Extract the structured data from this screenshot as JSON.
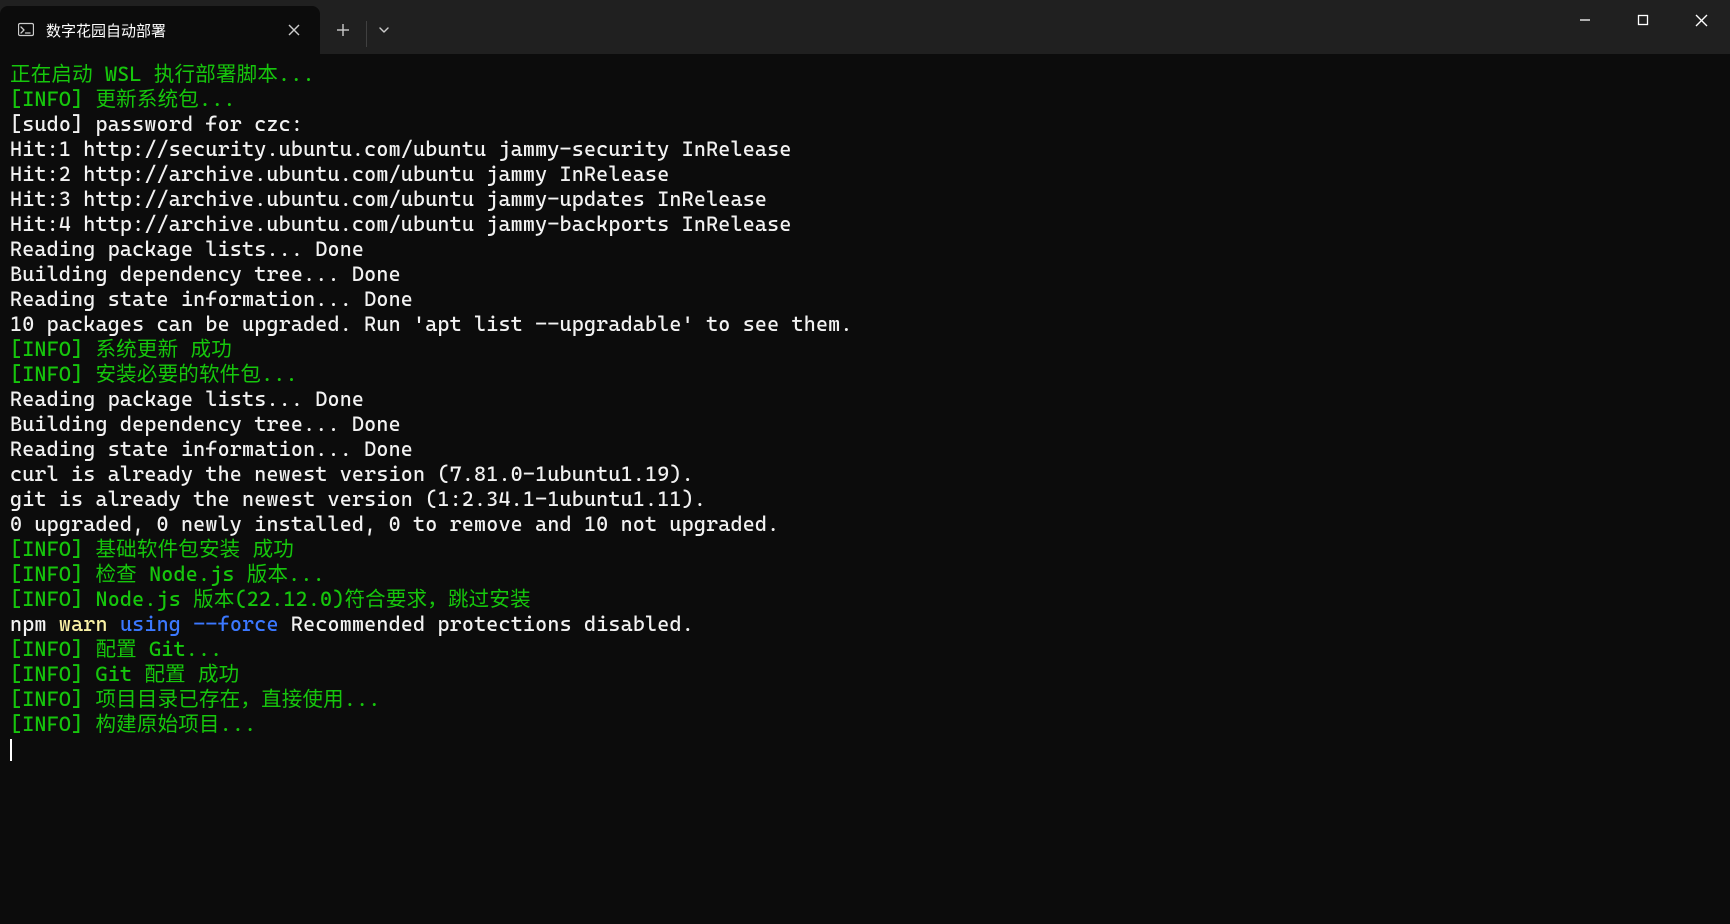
{
  "window": {
    "tab_title": "数字花园自动部署"
  },
  "colors": {
    "green": "#16c60c",
    "white": "#f2f2f2",
    "yellow": "#f9f1a5",
    "blue": "#3b78ff"
  },
  "lines": [
    {
      "segments": [
        {
          "text": "正在启动 WSL 执行部署脚本...",
          "cls": "c-green"
        }
      ]
    },
    {
      "segments": [
        {
          "text": "",
          "cls": "c-white"
        }
      ]
    },
    {
      "segments": [
        {
          "text": "[INFO] 更新系统包...",
          "cls": "c-green"
        }
      ]
    },
    {
      "segments": [
        {
          "text": "[sudo] password for czc:",
          "cls": "c-white"
        }
      ]
    },
    {
      "segments": [
        {
          "text": "Hit:1 http://security.ubuntu.com/ubuntu jammy-security InRelease",
          "cls": "c-white"
        }
      ]
    },
    {
      "segments": [
        {
          "text": "Hit:2 http://archive.ubuntu.com/ubuntu jammy InRelease",
          "cls": "c-white"
        }
      ]
    },
    {
      "segments": [
        {
          "text": "Hit:3 http://archive.ubuntu.com/ubuntu jammy-updates InRelease",
          "cls": "c-white"
        }
      ]
    },
    {
      "segments": [
        {
          "text": "Hit:4 http://archive.ubuntu.com/ubuntu jammy-backports InRelease",
          "cls": "c-white"
        }
      ]
    },
    {
      "segments": [
        {
          "text": "Reading package lists... Done",
          "cls": "c-white"
        }
      ]
    },
    {
      "segments": [
        {
          "text": "Building dependency tree... Done",
          "cls": "c-white"
        }
      ]
    },
    {
      "segments": [
        {
          "text": "Reading state information... Done",
          "cls": "c-white"
        }
      ]
    },
    {
      "segments": [
        {
          "text": "10 packages can be upgraded. Run 'apt list --upgradable' to see them.",
          "cls": "c-white"
        }
      ]
    },
    {
      "segments": [
        {
          "text": "[INFO] 系统更新 成功",
          "cls": "c-green"
        }
      ]
    },
    {
      "segments": [
        {
          "text": "[INFO] 安装必要的软件包...",
          "cls": "c-green"
        }
      ]
    },
    {
      "segments": [
        {
          "text": "Reading package lists... Done",
          "cls": "c-white"
        }
      ]
    },
    {
      "segments": [
        {
          "text": "Building dependency tree... Done",
          "cls": "c-white"
        }
      ]
    },
    {
      "segments": [
        {
          "text": "Reading state information... Done",
          "cls": "c-white"
        }
      ]
    },
    {
      "segments": [
        {
          "text": "curl is already the newest version (7.81.0-1ubuntu1.19).",
          "cls": "c-white"
        }
      ]
    },
    {
      "segments": [
        {
          "text": "git is already the newest version (1:2.34.1-1ubuntu1.11).",
          "cls": "c-white"
        }
      ]
    },
    {
      "segments": [
        {
          "text": "0 upgraded, 0 newly installed, 0 to remove and 10 not upgraded.",
          "cls": "c-white"
        }
      ]
    },
    {
      "segments": [
        {
          "text": "[INFO] 基础软件包安装 成功",
          "cls": "c-green"
        }
      ]
    },
    {
      "segments": [
        {
          "text": "[INFO] 检查 Node.js 版本...",
          "cls": "c-green"
        }
      ]
    },
    {
      "segments": [
        {
          "text": "[INFO] Node.js 版本(22.12.0)符合要求，跳过安装",
          "cls": "c-green"
        }
      ]
    },
    {
      "segments": [
        {
          "text": "npm ",
          "cls": "c-white"
        },
        {
          "text": "warn",
          "cls": "c-yellow"
        },
        {
          "text": " ",
          "cls": "c-white"
        },
        {
          "text": "using --force",
          "cls": "c-blue"
        },
        {
          "text": " Recommended protections disabled.",
          "cls": "c-white"
        }
      ]
    },
    {
      "segments": [
        {
          "text": "[INFO] 配置 Git...",
          "cls": "c-green"
        }
      ]
    },
    {
      "segments": [
        {
          "text": "[INFO] Git 配置 成功",
          "cls": "c-green"
        }
      ]
    },
    {
      "segments": [
        {
          "text": "[INFO] 项目目录已存在，直接使用...",
          "cls": "c-green"
        }
      ]
    },
    {
      "segments": [
        {
          "text": "[INFO] 构建原始项目...",
          "cls": "c-green"
        }
      ]
    }
  ]
}
